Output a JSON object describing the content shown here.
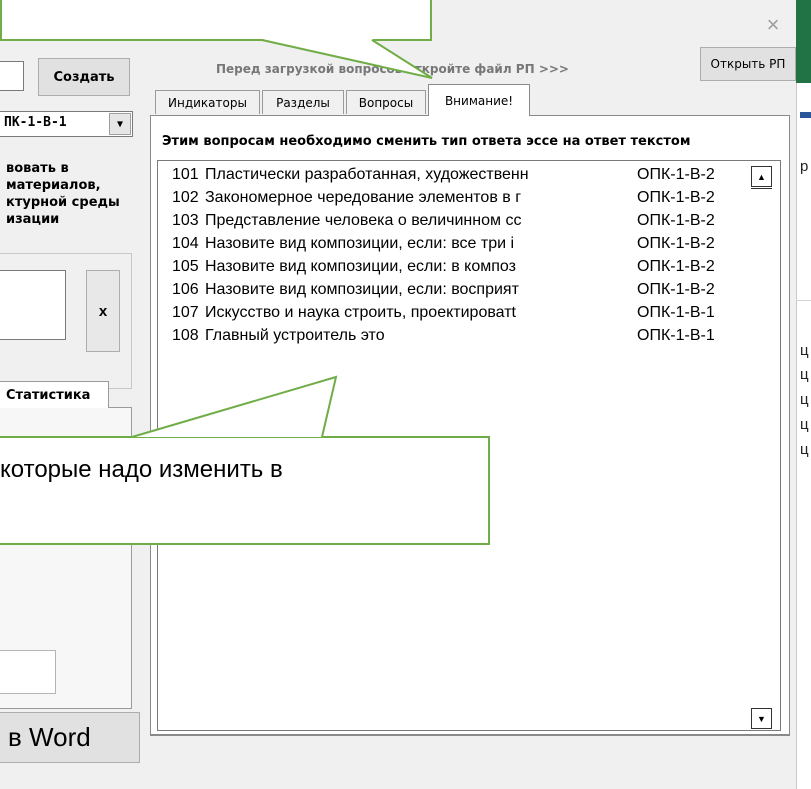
{
  "colors": {
    "callout_border": "#70ad47",
    "excel_green": "#217346",
    "excel_blue": "#2b579a"
  },
  "background_form": {
    "create_button": "Создать",
    "combo_value": "ПК-1-В-1",
    "description_lines": [
      "вовать в",
      "материалов,",
      "ктурной среды",
      "изации"
    ],
    "clear_button": "x",
    "stats_tab": "Статистика",
    "word_button": "в Word"
  },
  "excel_strip": {
    "cell_text": "р",
    "col_chars": [
      "ц",
      "ц",
      "ц",
      "ц",
      "ц"
    ]
  },
  "dialog": {
    "close_icon": "×",
    "hint": "Перед загрузкой вопросов откройте файл РП >>>",
    "open_button": "Открыть РП",
    "tabs": [
      {
        "label": "Индикаторы",
        "active": false
      },
      {
        "label": "Разделы",
        "active": false
      },
      {
        "label": "Вопросы",
        "active": false
      },
      {
        "label": "Внимание!",
        "active": true
      }
    ],
    "warning": "Этим вопросам необходимо сменить тип ответа эссе на ответ текстом",
    "questions": [
      {
        "num": "101",
        "text": "Пластически разработанная, художественн",
        "competence": "ОПК-1-В-2"
      },
      {
        "num": "102",
        "text": "Закономерное чередование элементов в г",
        "competence": "ОПК-1-В-2"
      },
      {
        "num": "103",
        "text": "Представление человека о величинном сс",
        "competence": "ОПК-1-В-2"
      },
      {
        "num": "104",
        "text": "Назовите вид композиции, если: все три і",
        "competence": "ОПК-1-В-2"
      },
      {
        "num": "105",
        "text": "Назовите вид композиции, если: в композ",
        "competence": "ОПК-1-В-2"
      },
      {
        "num": "106",
        "text": "Назовите вид композиции, если: восприят",
        "competence": "ОПК-1-В-2"
      },
      {
        "num": "107",
        "text": "Искусство и наука строить, проектироватt",
        "competence": "ОПК-1-В-1"
      },
      {
        "num": "108",
        "text": "Главный устроитель это",
        "competence": "ОПК-1-В-1"
      }
    ],
    "scroll_up": "▲",
    "scroll_down": "▼"
  },
  "callouts": {
    "bottom_text": "которые надо изменить в"
  }
}
